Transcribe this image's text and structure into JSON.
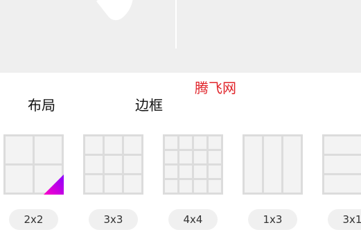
{
  "watermark": "腾飞网",
  "tabs": {
    "layout": "布局",
    "border": "边框"
  },
  "layouts": [
    {
      "label": "2x2",
      "icon": "grid-2x2-icon",
      "selected": true
    },
    {
      "label": "3x3",
      "icon": "grid-3x3-icon"
    },
    {
      "label": "4x4",
      "icon": "grid-4x4-icon"
    },
    {
      "label": "1x3",
      "icon": "grid-1x3-icon"
    },
    {
      "label": "3x1",
      "icon": "grid-3x1-icon"
    }
  ],
  "colors": {
    "grid_frame": "#dcdcdc",
    "grid_cell": "#f3f3f3",
    "selected_corner_start": "#ff00c8",
    "selected_corner_end": "#8a00ff",
    "watermark": "#e0242a"
  }
}
